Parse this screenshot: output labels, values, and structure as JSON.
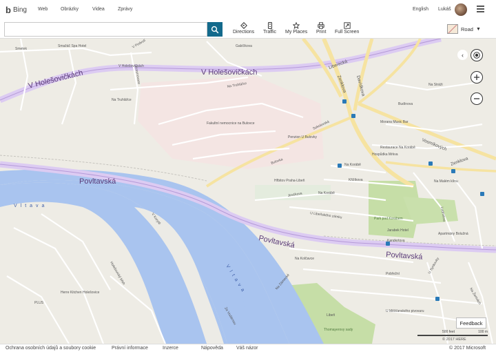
{
  "nav": {
    "brand": "Bing",
    "links": [
      "Web",
      "Obrázky",
      "Videa",
      "Zprávy"
    ],
    "language": "English",
    "user": "Lukáš"
  },
  "toolbar": {
    "search_value": "",
    "tools": [
      "Directions",
      "Traffic",
      "My Places",
      "Print",
      "Full Screen"
    ],
    "map_style": "Road"
  },
  "map": {
    "major_streets": [
      "V Holešovičkách",
      "V Holešovičkách",
      "Povltavská",
      "Povltavská",
      "Povltavská",
      "Liberecká",
      "Zenklova",
      "Zenklova",
      "Davídkova",
      "Vosmíkových"
    ],
    "river": "Vltava",
    "streets": [
      "Smetek",
      "Smažáč Spa Hotel",
      "V Holešovičkách",
      "V Podvolí",
      "Na Truhlářce",
      "Na Truhlářce",
      "Gabčíkova",
      "Na Stráži",
      "Budínova",
      "Bulovka",
      "Sokolovská",
      "Na Korábě",
      "Křižíkova",
      "Kandertova",
      "U Libeňského zámku",
      "Na Kolčavce",
      "Pobřežní",
      "Ludmilina",
      "Libeň",
      "U Měšťanského pivovaru",
      "Thomayerovy sady",
      "Na Žertvách",
      "U Synkovky",
      "Jirečkova",
      "Na Malém klínu",
      "Holešovický břeh",
      "V Korytě",
      "Korunovace",
      "Za Vodárnou",
      "Na Zámecké"
    ],
    "pois": [
      "Fakultní nemocnice na Bulovce",
      "Penzion U Bulovky",
      "Hřbitov Praha-Libeň",
      "Na Korábě",
      "Park pod Korábem",
      "Jarabek Hotel",
      "Apartmány Bolužná",
      "Restaurace Na Korábě",
      "Hospůdka Mrkva",
      "Morana Music Bar",
      "Herre Kitchen Holešovice",
      "PLUS"
    ],
    "park_label": "Park pod Korábem"
  },
  "controls": {
    "feedback": "Feedback",
    "scale_left": "500 feet",
    "scale_right": "100 m",
    "copyright": "© 2017 HERE"
  },
  "footer": {
    "links": [
      "Ochrana osobních údajů a soubory cookie",
      "Právní informace",
      "Inzerce",
      "Nápověda",
      "Váš názor"
    ],
    "microsoft": "© 2017 Microsoft"
  }
}
